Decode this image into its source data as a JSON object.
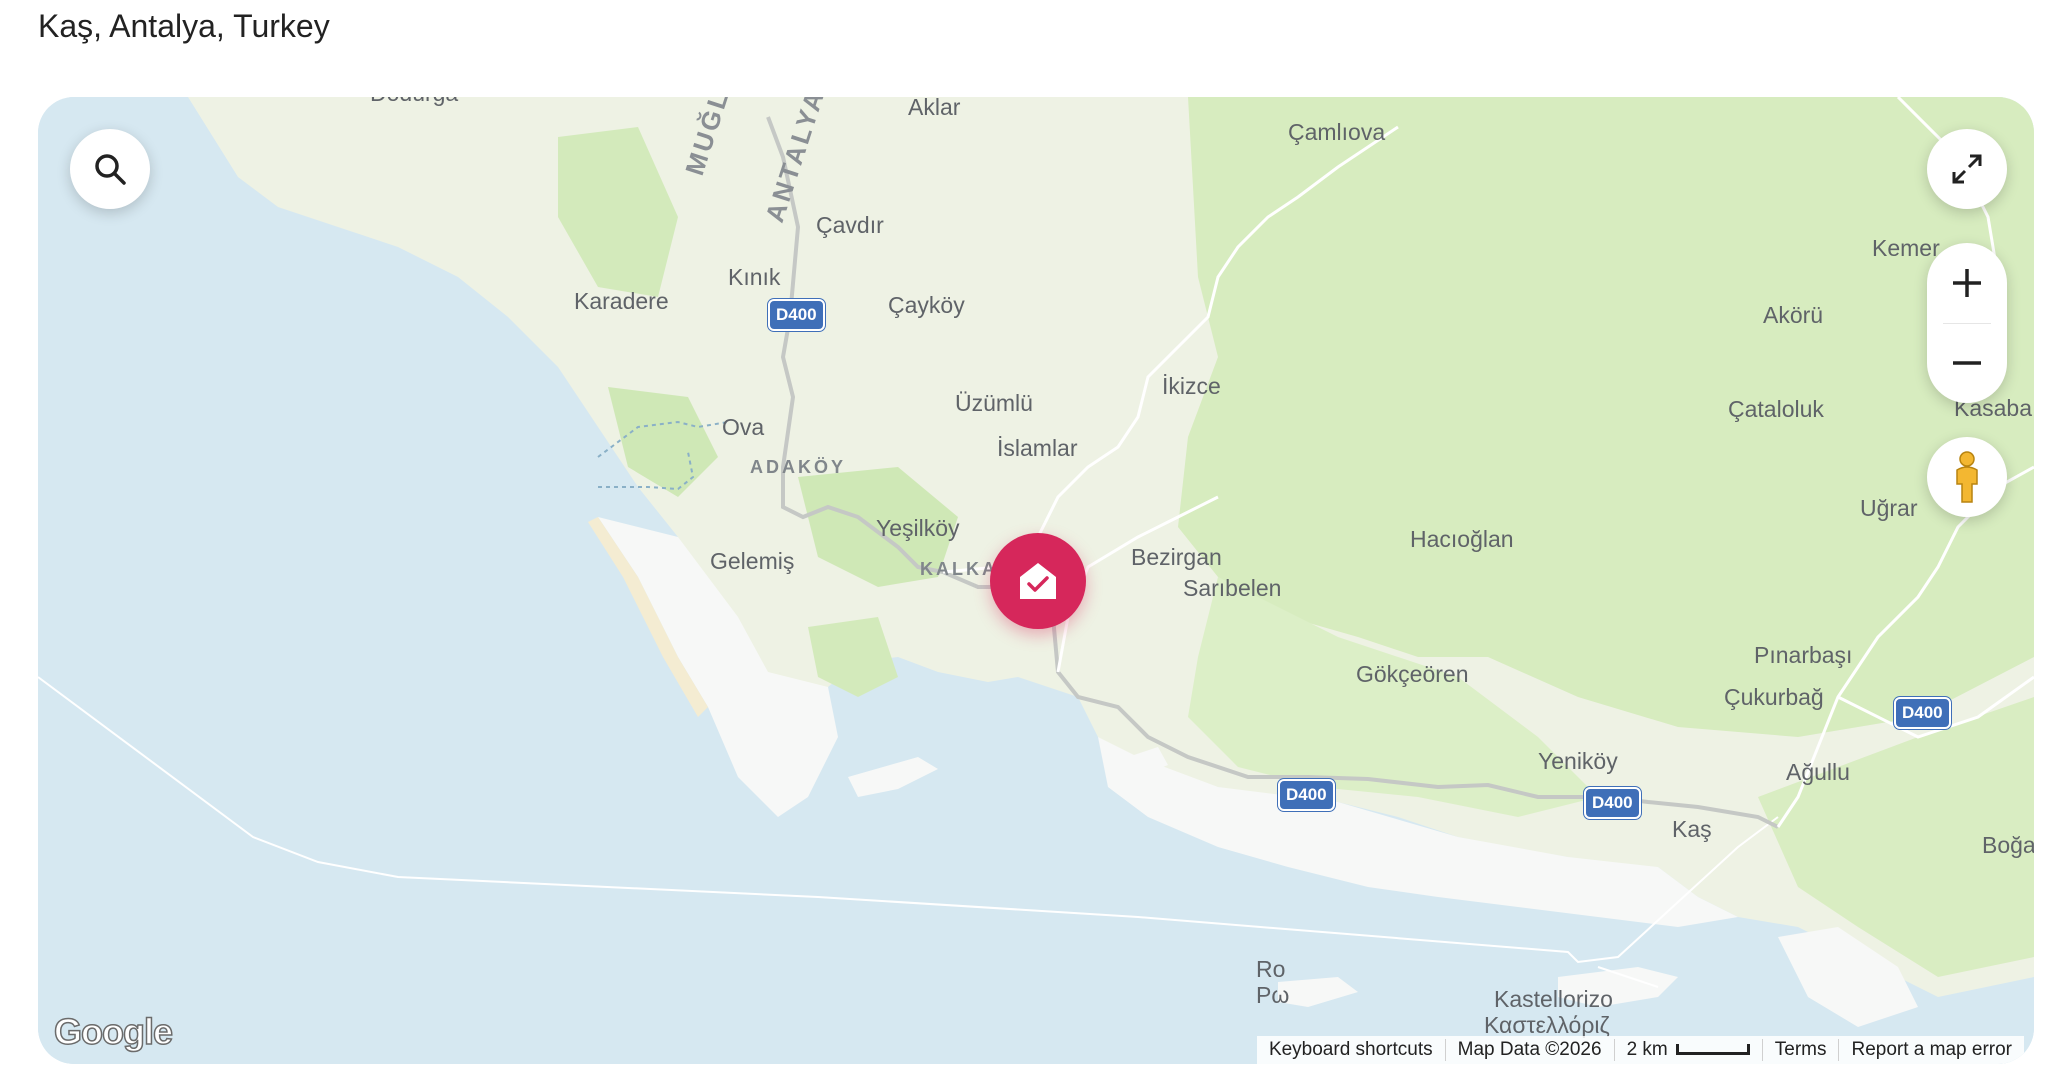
{
  "page": {
    "location_title": "Kaş, Antalya, Turkey"
  },
  "map": {
    "colors": {
      "sea": "#d6e8f1",
      "land": "#eef2e4",
      "forest": "#d7ecbf",
      "accent": "#d6275b",
      "road_shield": "#3f6fb8"
    },
    "place_labels": {
      "dodurga": "Dodurga",
      "aklar": "Aklar",
      "camliova": "Çamlıova",
      "cavdir": "Çavdır",
      "karadere": "Karadere",
      "kinik": "Kınık",
      "caykoy": "Çayköy",
      "kemer": "Kemer",
      "akoru": "Akörü",
      "uzumlu": "Üzümlü",
      "ikizce": "İkizce",
      "ova": "Ova",
      "cataloluk": "Çataloluk",
      "kasaba": "Kasaba",
      "islamlar": "İslamlar",
      "ugrar": "Uğrar",
      "yesilkoy": "Yeşilköy",
      "gelemis": "Gelemiş",
      "bezirgan": "Bezirgan",
      "haciooglan": "Hacıoğlan",
      "saribelen": "Sarıbelen",
      "gokceoren": "Gökçeören",
      "pinarbasi": "Pınarbaşı",
      "cukurbag": "Çukurbağ",
      "yenikoy": "Yeniköy",
      "agullu": "Ağullu",
      "kas": "Kaş",
      "bogaz": "Boğaz",
      "ro": "Ro",
      "ro_greek": "Ρω",
      "kastellorizo": "Kastellorizo",
      "kastellorizo_greek": "Καστελλόριζ"
    },
    "district_labels": {
      "adakoy": "ADAKÖY",
      "kalkan": "KALKAN"
    },
    "province_labels": {
      "mugla": "MUĞLA",
      "antalya": "ANTALYA"
    },
    "road_shields": {
      "label": "D400"
    },
    "icons": {
      "search": "search-icon",
      "fullscreen": "fullscreen-icon",
      "zoom_in": "plus-icon",
      "zoom_out": "minus-icon",
      "street_view": "pegman-icon",
      "pin": "home-check-icon"
    },
    "google_logo": "Google",
    "attribution": {
      "keyboard": "Keyboard shortcuts",
      "map_data": "Map Data ©2026",
      "scale": "2 km",
      "terms": "Terms",
      "report": "Report a map error"
    }
  }
}
